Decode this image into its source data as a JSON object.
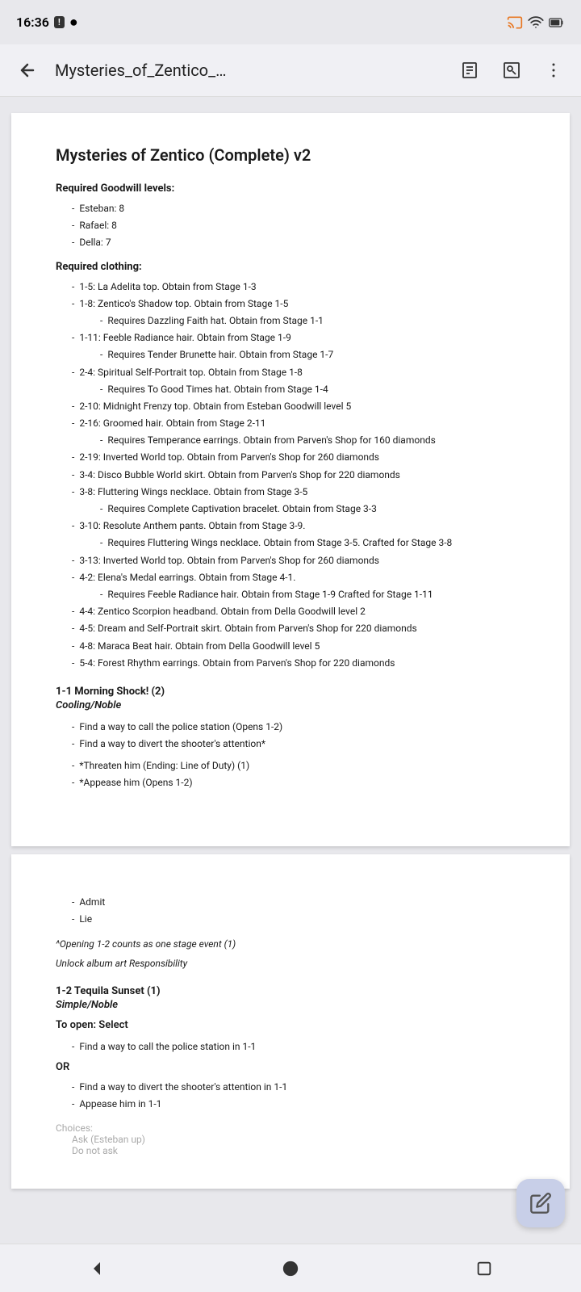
{
  "statusBar": {
    "time": "16:36",
    "alert": "!",
    "circle": "●"
  },
  "appBar": {
    "title": "Mysteries_of_Zentico_…",
    "backLabel": "back",
    "menuLabel": "more"
  },
  "document": {
    "title": "Mysteries of Zentico (Complete) v2",
    "requiredGoodwillHeading": "Required Goodwill levels:",
    "goodwillItems": [
      "Esteban: 8",
      "Rafael: 8",
      "Della: 7"
    ],
    "requiredClothingHeading": "Required clothing:",
    "clothingItems": [
      {
        "text": "1-5: La Adelita top. Obtain from Stage 1-3",
        "indent": 0,
        "sub": null
      },
      {
        "text": "1-8: Zentico's Shadow top. Obtain from Stage 1-5",
        "indent": 0,
        "sub": "Requires Dazzling Faith hat. Obtain from Stage 1-1"
      },
      {
        "text": "1-11: Feeble Radiance hair. Obtain from Stage 1-9",
        "indent": 0,
        "sub": "Requires Tender Brunette hair. Obtain from Stage 1-7"
      },
      {
        "text": "2-4: Spiritual Self-Portrait top. Obtain from Stage 1-8",
        "indent": 0,
        "sub": "Requires To Good Times hat. Obtain from Stage 1-4"
      },
      {
        "text": "2-10: Midnight Frenzy top. Obtain from Esteban Goodwill level 5",
        "indent": 0,
        "sub": null
      },
      {
        "text": "2-16: Groomed hair. Obtain from Stage 2-11",
        "indent": 0,
        "sub": "Requires Temperance earrings. Obtain from Parven's Shop for 160 diamonds"
      },
      {
        "text": "2-19: Inverted World top. Obtain from Parven's Shop for 260 diamonds",
        "indent": 0,
        "sub": null
      },
      {
        "text": "3-4: Disco Bubble World skirt. Obtain from Parven's Shop for 220 diamonds",
        "indent": 0,
        "sub": null
      },
      {
        "text": "3-8: Fluttering Wings necklace. Obtain from Stage 3-5",
        "indent": 0,
        "sub": "Requires Complete Captivation bracelet. Obtain from Stage 3-3"
      },
      {
        "text": "3-10: Resolute Anthem pants. Obtain from Stage 3-9.",
        "indent": 0,
        "sub": "Requires Fluttering Wings necklace. Obtain from Stage 3-5. Crafted for Stage 3-8"
      },
      {
        "text": "3-13: Inverted World top. Obtain from Parven's Shop for 260 diamonds",
        "indent": 0,
        "sub": null
      },
      {
        "text": "4-2: Elena's Medal earrings. Obtain from Stage 4-1.",
        "indent": 0,
        "sub": "Requires Feeble Radiance hair. Obtain from Stage 1-9 Crafted for Stage 1-11"
      },
      {
        "text": "4-4: Zentico Scorpion headband. Obtain from Della Goodwill level 2",
        "indent": 0,
        "sub": null
      },
      {
        "text": "4-5: Dream and Self-Portrait skirt. Obtain from Parven's Shop for 220 diamonds",
        "indent": 0,
        "sub": null
      },
      {
        "text": "4-8: Maraca Beat hair. Obtain from Della Goodwill level 5",
        "indent": 0,
        "sub": null
      },
      {
        "text": "5-4: Forest Rhythm earrings. Obtain from Parven's Shop for 220 diamonds",
        "indent": 0,
        "sub": null
      }
    ],
    "stage1Heading": "1-1 Morning Shock! (2)",
    "stage1Style": "Cooling/Noble",
    "stage1Tasks": [
      "Find a way to call the police station (Opens 1-2)",
      "Find a way to divert the shooter's attention*"
    ],
    "stage1Choices": [
      "*Threaten him (Ending: Line of Duty) (1)",
      "*Appease him (Opens 1-2)"
    ],
    "page2Items": [
      "Admit",
      "Lie"
    ],
    "page2Note": "^Opening 1-2 counts as one stage event (1)",
    "page2Unlock": "Unlock album art Responsibility",
    "stage2Heading": "1-2 Tequila Sunset (1)",
    "stage2Style": "Simple/Noble",
    "stage2Open": "To open: Select",
    "stage2Task": "Find a way to call the police station in 1-1",
    "orText": "OR",
    "stage2AltTasks": [
      "Find a way to divert the shooter's attention in 1-1",
      "Appease him in 1-1"
    ],
    "choicesLabel": "Choices:",
    "choicesSub1": "Ask (Esteban up)",
    "choicesSub2": "Do not ask"
  },
  "fab": {
    "icon": "edit"
  }
}
